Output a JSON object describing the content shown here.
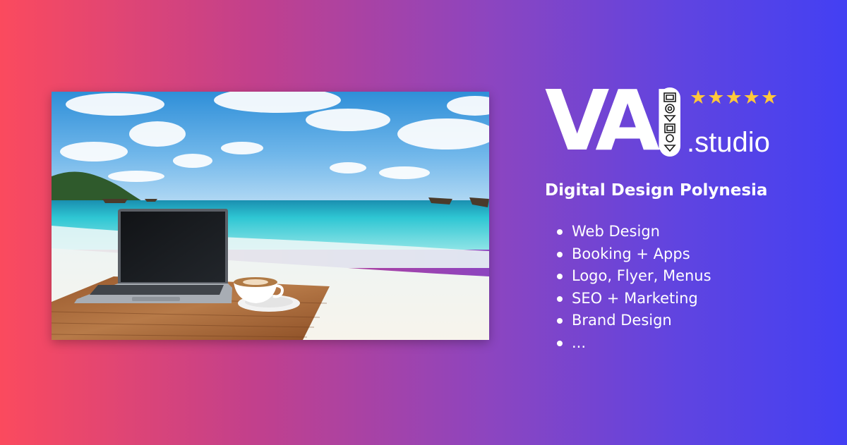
{
  "brand": {
    "logo_mark": "VAI",
    "domain_suffix": ".studio",
    "rating_stars": 5,
    "star_color": "#ffc83a"
  },
  "tagline": "Digital Design Polynesia",
  "services": [
    "Web Design",
    "Booking + Apps",
    "Logo, Flyer, Menus",
    "SEO + Marketing",
    "Brand Design",
    "..."
  ],
  "photo": {
    "subject": "beach-workspace-photo"
  },
  "colors": {
    "gradient_start": "#fb4a5e",
    "gradient_end": "#4340f3",
    "text": "#ffffff"
  }
}
